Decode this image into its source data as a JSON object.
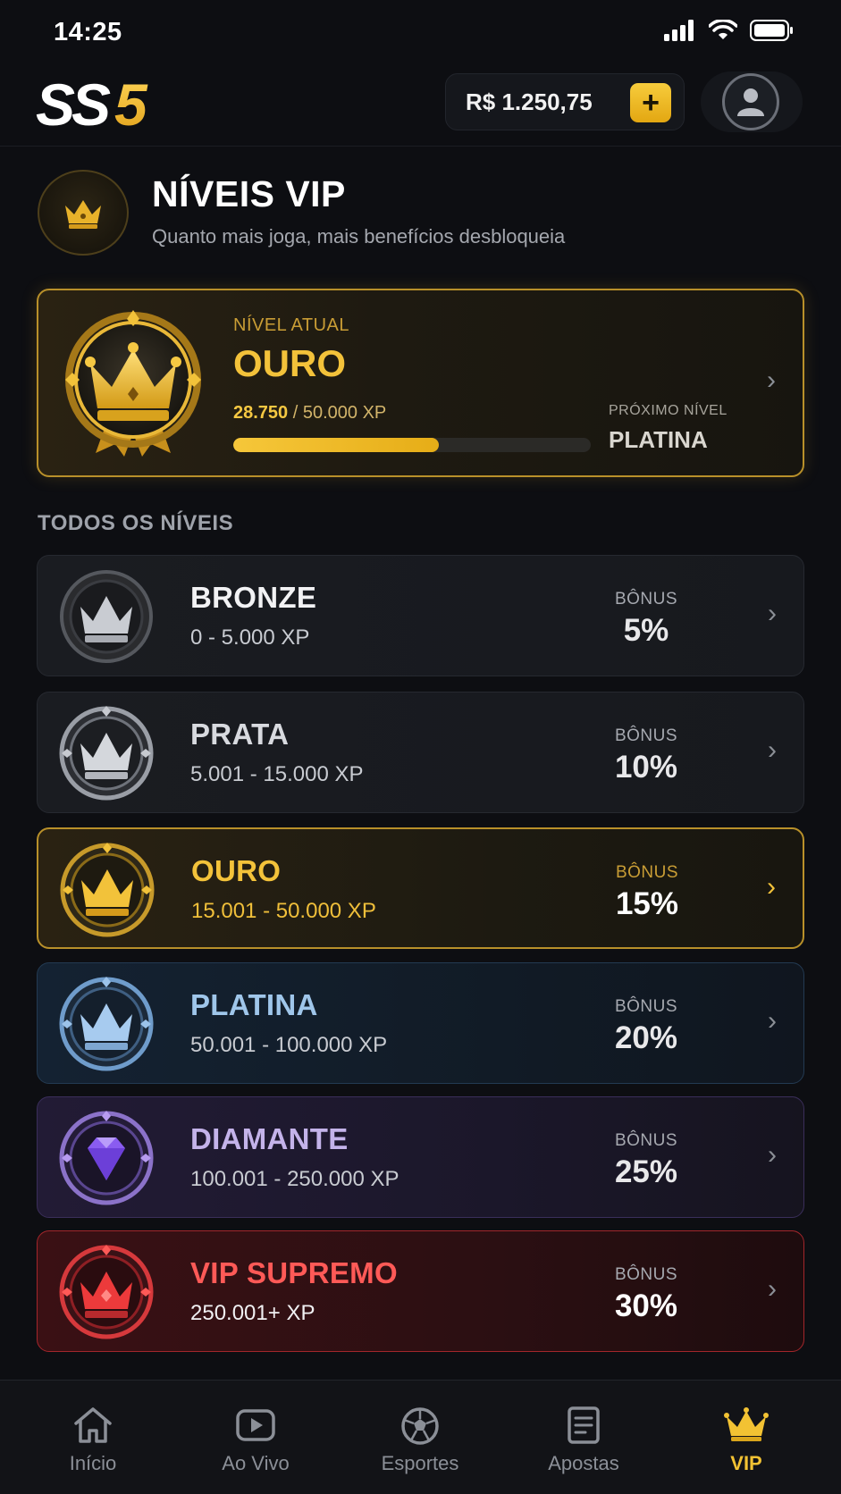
{
  "status": {
    "time": "14:25"
  },
  "header": {
    "logo": "SS5",
    "balance": "R$ 1.250,75",
    "add_label": "+"
  },
  "page": {
    "title": "NÍVEIS VIP",
    "subtitle": "Quanto mais joga, mais benefícios desbloqueia"
  },
  "current": {
    "label": "NÍVEL ATUAL",
    "name": "OURO",
    "xp_current": "28.750",
    "xp_rest": " / 50.000 XP",
    "progress": 0.575,
    "next_label": "PRÓXIMO NÍVEL",
    "next_name": "PLATINA"
  },
  "section_heading": "TODOS OS NÍVEIS",
  "levels": [
    {
      "name": "BRONZE",
      "range": "0 - 5.000 XP",
      "bonus_label": "BÔNUS",
      "bonus": "5%",
      "color": "#f2f2f4"
    },
    {
      "name": "PRATA",
      "range": "5.001 - 15.000 XP",
      "bonus_label": "BÔNUS",
      "bonus": "10%",
      "color": "#d8dadf"
    },
    {
      "name": "OURO",
      "range": "15.001 - 50.000 XP",
      "bonus_label": "BÔNUS",
      "bonus": "15%",
      "color": "#f3c23a"
    },
    {
      "name": "PLATINA",
      "range": "50.001 - 100.000 XP",
      "bonus_label": "BÔNUS",
      "bonus": "20%",
      "color": "#9fc6ea"
    },
    {
      "name": "DIAMANTE",
      "range": "100.001 - 250.000 XP",
      "bonus_label": "BÔNUS",
      "bonus": "25%",
      "color": "#c4b3ea"
    },
    {
      "name": "VIP SUPREMO",
      "range": "250.001+ XP",
      "bonus_label": "BÔNUS",
      "bonus": "30%",
      "color": "#ff5a57"
    }
  ],
  "tabs": [
    {
      "label": "Início",
      "icon": "home-icon"
    },
    {
      "label": "Ao Vivo",
      "icon": "live-icon"
    },
    {
      "label": "Esportes",
      "icon": "ball-icon"
    },
    {
      "label": "Apostas",
      "icon": "bets-icon"
    },
    {
      "label": "VIP",
      "icon": "crown-icon",
      "active": true
    }
  ],
  "colors": {
    "gold": "#f3c23a",
    "background": "#0d0e12"
  }
}
